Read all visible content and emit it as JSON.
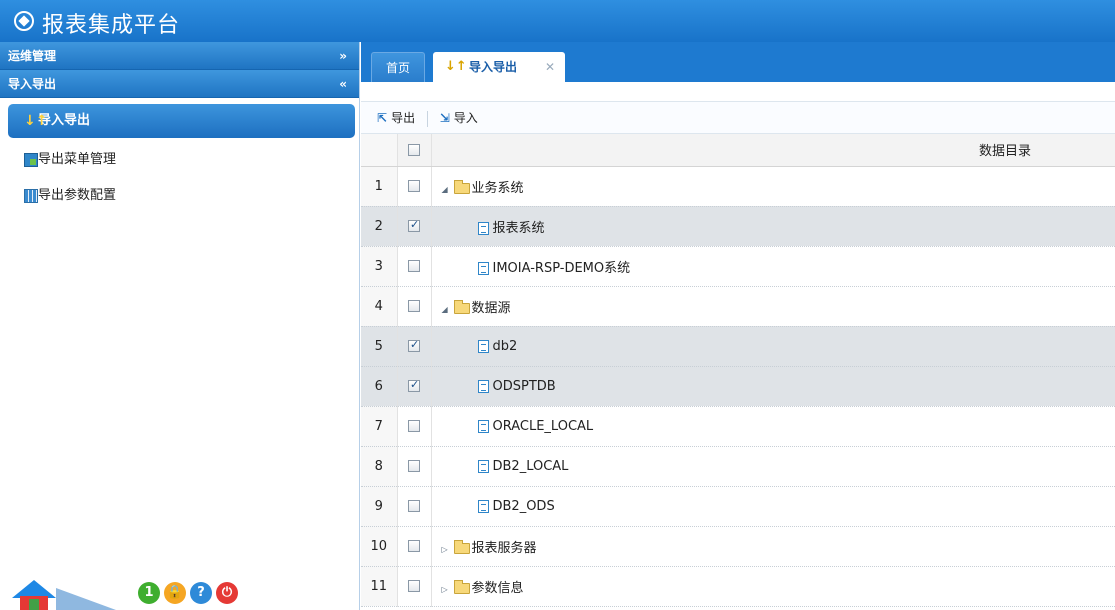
{
  "header": {
    "title": "报表集成平台"
  },
  "sidebar": {
    "sections": [
      {
        "label": "运维管理",
        "chevron": "»"
      },
      {
        "label": "导入导出",
        "chevron": "«"
      }
    ],
    "items": [
      {
        "label": "导入导出",
        "icon": "↓↑"
      },
      {
        "label": "导出菜单管理"
      },
      {
        "label": "导出参数配置"
      }
    ],
    "bottom": {
      "user": "1",
      "lock": "🔒",
      "help": "?",
      "power": "⏻"
    }
  },
  "tabs": {
    "home": "首页",
    "current": "导入导出",
    "current_icon": "↓↑",
    "close": "✕"
  },
  "toolbar": {
    "export": "导出",
    "export_icon": "⇱",
    "import": "导入",
    "import_icon": "⇲"
  },
  "table": {
    "header": "数据目录",
    "rows": [
      {
        "num": "1",
        "label": "业务系统"
      },
      {
        "num": "2",
        "label": "报表系统"
      },
      {
        "num": "3",
        "label": "IMOIA-RSP-DEMO系统"
      },
      {
        "num": "4",
        "label": "数据源"
      },
      {
        "num": "5",
        "label": "db2"
      },
      {
        "num": "6",
        "label": "ODSPTDB"
      },
      {
        "num": "7",
        "label": "ORACLE_LOCAL"
      },
      {
        "num": "8",
        "label": "DB2_LOCAL"
      },
      {
        "num": "9",
        "label": "DB2_ODS"
      },
      {
        "num": "10",
        "label": "报表服务器"
      },
      {
        "num": "11",
        "label": "参数信息"
      }
    ]
  },
  "tree_arrows": {
    "expanded": "◢",
    "collapsed": "▷"
  },
  "colors": {
    "accent": "#1e7ad0",
    "selected_row": "#dfe3e7",
    "folder": "#f7d87a"
  }
}
